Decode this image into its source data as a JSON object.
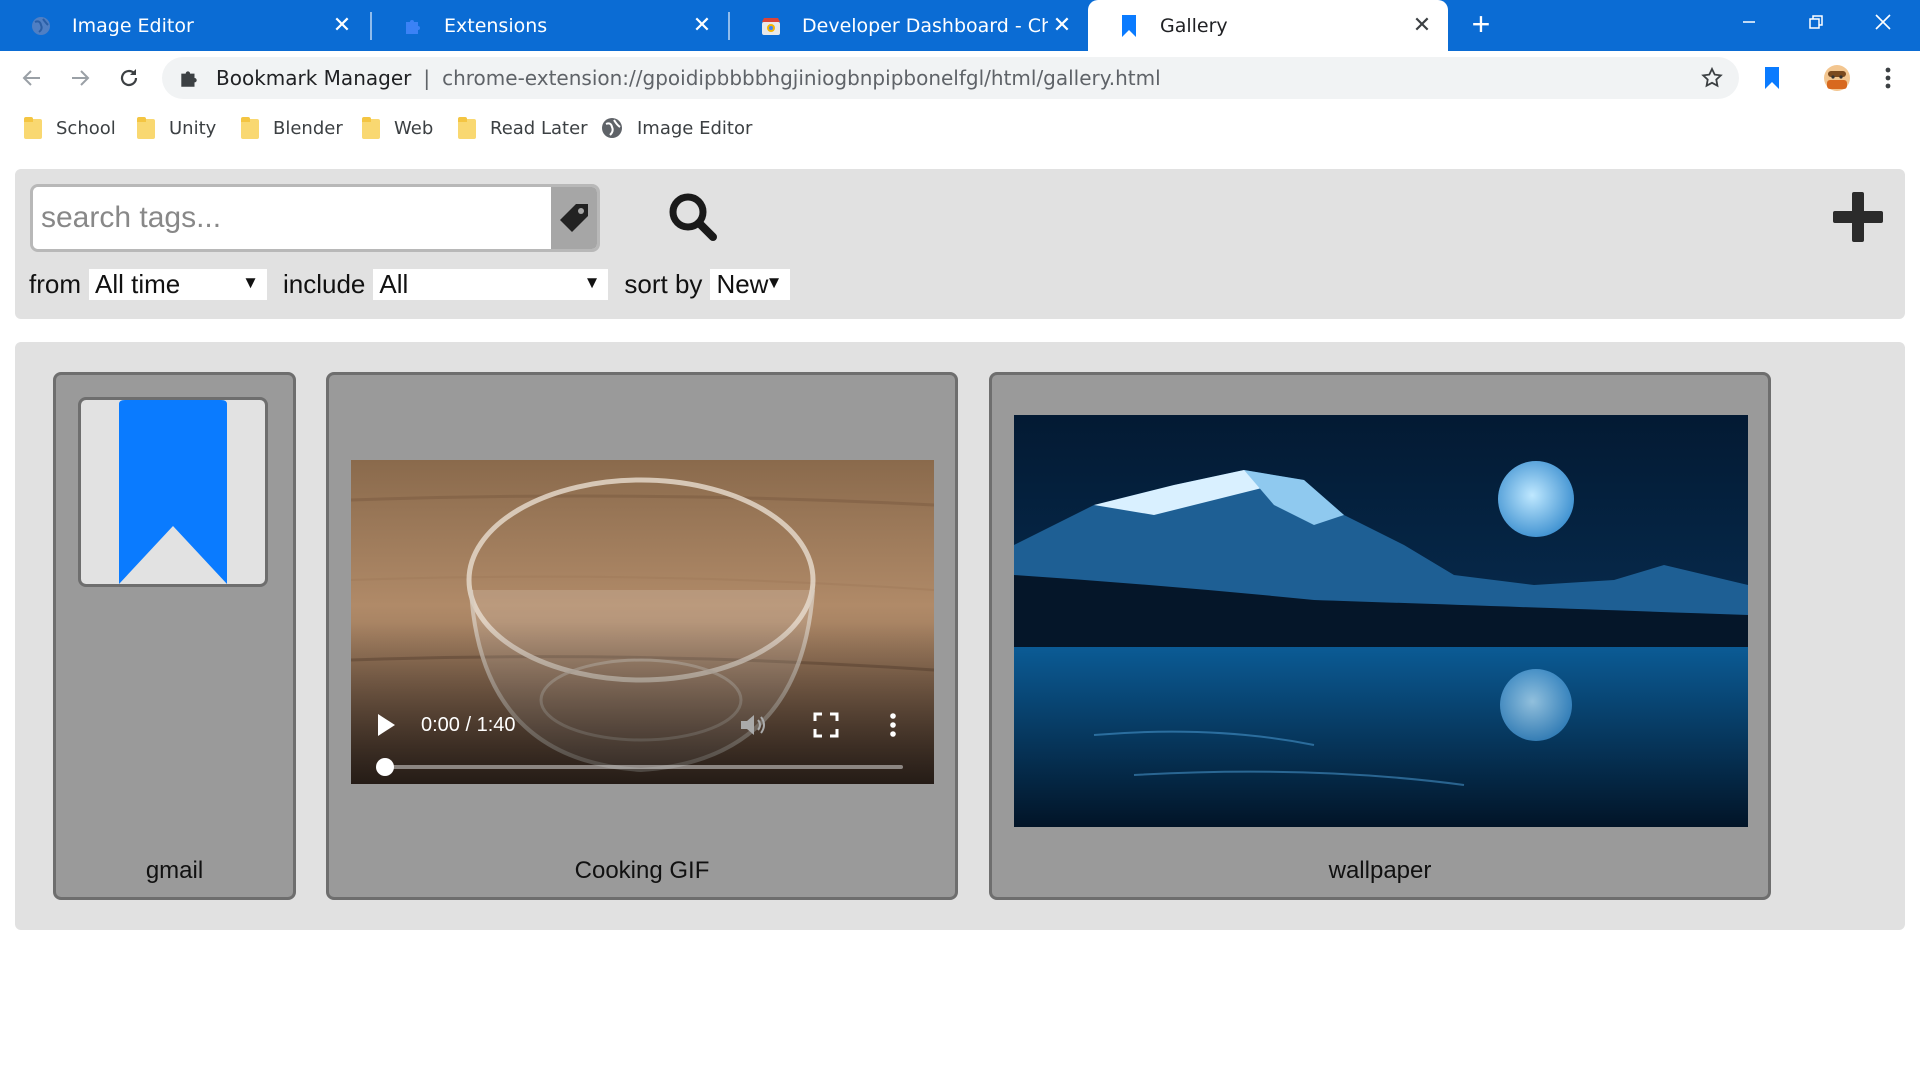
{
  "browser": {
    "tabs": [
      {
        "title": "Image Editor",
        "icon": "globe-icon"
      },
      {
        "title": "Extensions",
        "icon": "puzzle-icon"
      },
      {
        "title": "Developer Dashboard - Chrome W",
        "icon": "chrome-webstore-icon"
      },
      {
        "title": "Gallery",
        "icon": "bookmark-icon",
        "active": true
      }
    ],
    "omnibox": {
      "origin": "Bookmark Manager",
      "url": "chrome-extension://gpoidipbbbbhgjiniogbnpipbonelfgl/html/gallery.html"
    },
    "bookmarks": [
      {
        "label": "School",
        "icon": "folder-icon"
      },
      {
        "label": "Unity",
        "icon": "folder-icon"
      },
      {
        "label": "Blender",
        "icon": "folder-icon"
      },
      {
        "label": "Web",
        "icon": "folder-icon"
      },
      {
        "label": "Read Later",
        "icon": "folder-icon"
      },
      {
        "label": "Image Editor",
        "icon": "globe-icon"
      }
    ]
  },
  "search": {
    "placeholder": "search tags...",
    "from_label": "from",
    "from_value": "All time",
    "include_label": "include",
    "include_value": "All",
    "sort_label": "sort by",
    "sort_value": "New"
  },
  "gallery": {
    "items": [
      {
        "caption": "gmail",
        "type": "bookmark"
      },
      {
        "caption": "Cooking GIF",
        "type": "video",
        "time": "0:00 / 1:40"
      },
      {
        "caption": "wallpaper",
        "type": "image"
      }
    ]
  },
  "colors": {
    "tabstrip": "#0b6cd4",
    "bookmark_blue": "#0a7bff",
    "panel_gray": "#e1e1e1",
    "card_gray": "#9a9a9a"
  }
}
